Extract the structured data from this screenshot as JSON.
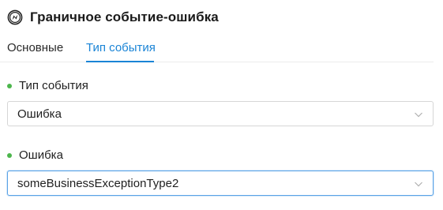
{
  "header": {
    "title": "Граничное событие-ошибка",
    "icon": "error-boundary-event-icon"
  },
  "tabs": [
    {
      "label": "Основные",
      "active": false
    },
    {
      "label": "Тип события",
      "active": true
    }
  ],
  "fields": {
    "event_type": {
      "label": "Тип события",
      "value": "Ошибка"
    },
    "error": {
      "label": "Ошибка",
      "value": "someBusinessExceptionType2"
    }
  },
  "colors": {
    "accent": "#1a84d6",
    "required_dot": "#4cb64c",
    "focus_border": "#5aa3e6"
  }
}
